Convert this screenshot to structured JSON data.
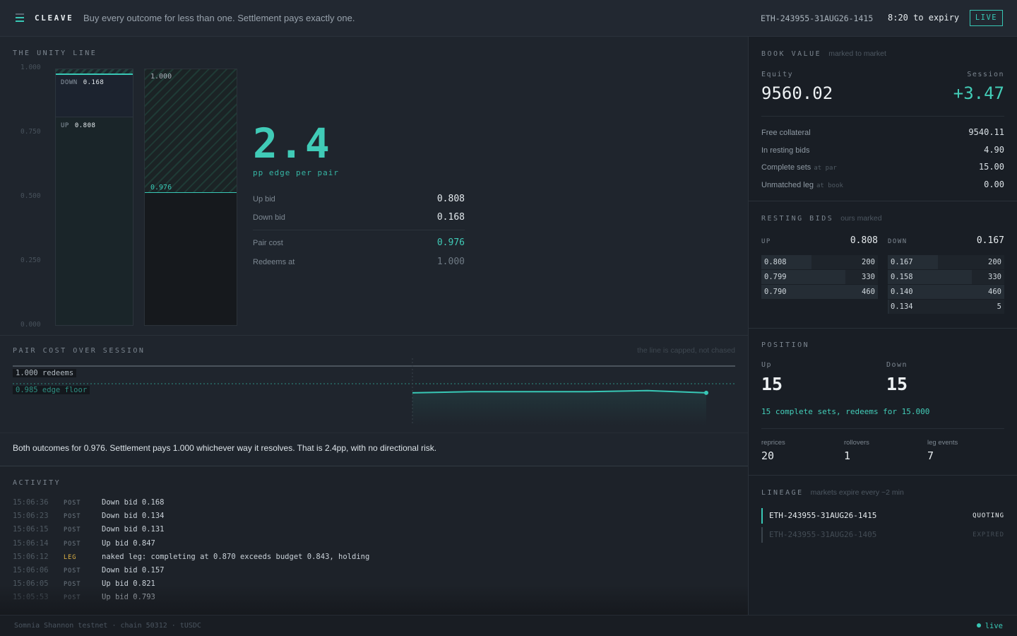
{
  "header": {
    "brand": "CLEAVE",
    "tagline": "Buy every outcome for less than one. Settlement pays exactly one.",
    "market_id": "ETH-243955-31AUG26-1415",
    "expiry": "8:20 to expiry",
    "live_badge": "LIVE"
  },
  "unity_line": {
    "title": "THE UNITY LINE",
    "axis_ticks": [
      "1.000",
      "0.750",
      "0.500",
      "0.250",
      "0.000"
    ],
    "current_bar": {
      "down_label": "DOWN",
      "down_value": "0.168",
      "up_label": "UP",
      "up_value": "0.808"
    },
    "pair_bar": {
      "top_label": "1.000",
      "cost_label": "0.976"
    },
    "edge_value": "2.4",
    "edge_caption": "pp edge per pair",
    "rows": [
      {
        "label": "Up bid",
        "value": "0.808"
      },
      {
        "label": "Down bid",
        "value": "0.168"
      },
      {
        "label": "Pair cost",
        "value": "0.976"
      },
      {
        "label": "Redeems at",
        "value": "1.000"
      }
    ]
  },
  "pair_cost_session": {
    "title": "PAIR COST OVER SESSION",
    "note": "the line is capped, not chased",
    "redeems_tag": "1.000  redeems",
    "floor_tag": "0.985  edge floor",
    "chart_data": {
      "type": "line",
      "series": [
        {
          "values": [
            0.976,
            0.977,
            0.977,
            0.977,
            0.978,
            0.976
          ]
        }
      ],
      "reference_lines": [
        {
          "label": "redeems",
          "value": 1.0
        },
        {
          "label": "edge floor",
          "value": 0.985
        }
      ]
    }
  },
  "summary": "Both outcomes for 0.976. Settlement pays 1.000 whichever way it resolves. That is 2.4pp, with no directional risk.",
  "activity": {
    "title": "ACTIVITY",
    "rows": [
      {
        "time": "15:06:36",
        "kind": "POST",
        "msg": "Down bid 0.168"
      },
      {
        "time": "15:06:23",
        "kind": "POST",
        "msg": "Down bid 0.134"
      },
      {
        "time": "15:06:15",
        "kind": "POST",
        "msg": "Down bid 0.131"
      },
      {
        "time": "15:06:14",
        "kind": "POST",
        "msg": "Up bid 0.847"
      },
      {
        "time": "15:06:12",
        "kind": "LEG",
        "msg": "naked leg: completing at 0.870 exceeds budget 0.843, holding"
      },
      {
        "time": "15:06:06",
        "kind": "POST",
        "msg": "Down bid 0.157"
      },
      {
        "time": "15:06:05",
        "kind": "POST",
        "msg": "Up bid 0.821"
      },
      {
        "time": "15:05:53",
        "kind": "POST",
        "msg": "Up bid 0.793"
      }
    ]
  },
  "book_value": {
    "title": "BOOK VALUE",
    "note": "marked to market",
    "equity_label": "Equity",
    "equity": "9560.02",
    "session_label": "Session",
    "session": "+3.47",
    "rows": [
      {
        "label": "Free collateral",
        "hint": "",
        "value": "9540.11"
      },
      {
        "label": "In resting bids",
        "hint": "",
        "value": "4.90"
      },
      {
        "label": "Complete sets",
        "hint": "at par",
        "value": "15.00"
      },
      {
        "label": "Unmatched leg",
        "hint": "at book",
        "value": "0.00"
      }
    ]
  },
  "resting_bids": {
    "title": "RESTING BIDS",
    "note": "ours marked",
    "up": {
      "label": "UP",
      "best": "0.808",
      "levels": [
        {
          "price": "0.808",
          "qty": "200",
          "depth": 0.43
        },
        {
          "price": "0.799",
          "qty": "330",
          "depth": 0.72
        },
        {
          "price": "0.790",
          "qty": "460",
          "depth": 1.0
        }
      ]
    },
    "down": {
      "label": "DOWN",
      "best": "0.167",
      "levels": [
        {
          "price": "0.167",
          "qty": "200",
          "depth": 0.43
        },
        {
          "price": "0.158",
          "qty": "330",
          "depth": 0.72
        },
        {
          "price": "0.140",
          "qty": "460",
          "depth": 1.0
        },
        {
          "price": "0.134",
          "qty": "5",
          "depth": 0.01
        }
      ]
    }
  },
  "position": {
    "title": "POSITION",
    "up_label": "Up",
    "up_value": "15",
    "down_label": "Down",
    "down_value": "15",
    "sets_text": "15 complete sets, redeems for 15.000",
    "stats": [
      {
        "label": "reprices",
        "value": "20"
      },
      {
        "label": "rollovers",
        "value": "1"
      },
      {
        "label": "leg events",
        "value": "7"
      }
    ]
  },
  "lineage": {
    "title": "LINEAGE",
    "note": "markets expire every ~2 min",
    "items": [
      {
        "id": "ETH-243955-31AUG26-1415",
        "status": "QUOTING"
      },
      {
        "id": "ETH-243955-31AUG26-1405",
        "status": "EXPIRED"
      }
    ]
  },
  "footer": {
    "network": "Somnia Shannon testnet · chain 50312 · tUSDC",
    "status": "live"
  },
  "colors": {
    "accent": "#38c7b5",
    "warning": "#e2b545",
    "background": "#1b2028"
  }
}
